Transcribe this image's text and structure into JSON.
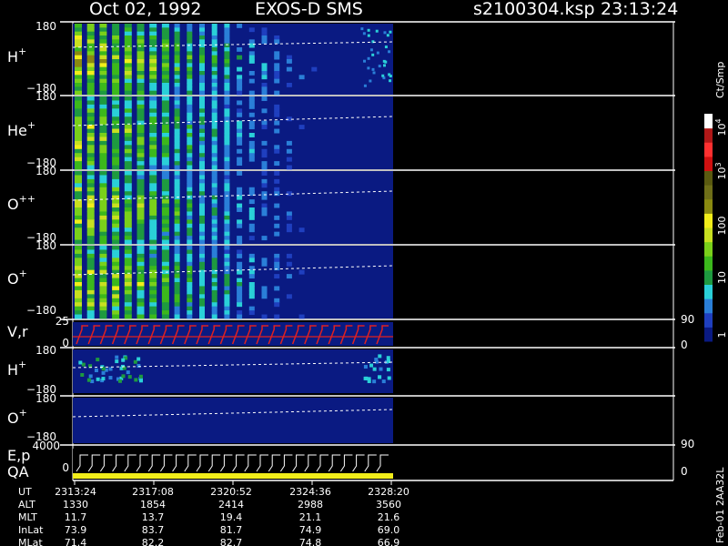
{
  "header": {
    "date": "Oct 02, 1992",
    "instrument": "EXOS-D SMS",
    "file": "s2100304.ksp",
    "time": "23:13:24"
  },
  "colorbar": {
    "unit_label": "Ct/Smp",
    "ticks": [
      {
        "base": "10",
        "exp": "4"
      },
      {
        "base": "10",
        "exp": "3"
      },
      {
        "base": "100",
        "exp": ""
      },
      {
        "base": "10",
        "exp": ""
      },
      {
        "base": "1",
        "exp": ""
      }
    ],
    "colors": [
      "#0a1a82",
      "#1f3fbf",
      "#2a7fd8",
      "#2ad0d8",
      "#1e9a40",
      "#3cb81c",
      "#7ad01a",
      "#c8e020",
      "#f2ee1a",
      "#8a8a10",
      "#6e6e18",
      "#5a5a10",
      "#d01010",
      "#ff3030",
      "#b01818",
      "#ffffff"
    ]
  },
  "side_label": "Feb-01 2AA32L",
  "panels": {
    "h_plus": {
      "name": "H",
      "charge": "+",
      "ymax": "180",
      "ymin": "−180"
    },
    "he_plus": {
      "name": "He",
      "charge": "+",
      "ymax": "180",
      "ymin": "−180"
    },
    "o_plusplus": {
      "name": "O",
      "charge": "++",
      "ymax": "180",
      "ymin": "−180"
    },
    "o_plus": {
      "name": "O",
      "charge": "+",
      "ymax": "180",
      "ymin": "−180"
    },
    "vr": {
      "name": "V,r",
      "left_top": "25",
      "left_bottom": "0",
      "right_top": "90",
      "right_bottom": "0"
    },
    "h_plus_2": {
      "name": "H",
      "charge": "+",
      "ymax": "180",
      "ymin": "−180"
    },
    "o_plus_2": {
      "name": "O",
      "charge": "+",
      "ymax": "180",
      "ymin": "−180"
    },
    "ep": {
      "name": "E,p",
      "name2": "QA",
      "left_top": "4000",
      "left_bottom": "0",
      "right_top": "90",
      "right_bottom": "0"
    }
  },
  "ephemeris": {
    "rows": [
      {
        "label": "UT",
        "values": [
          "2313:24",
          "2317:08",
          "2320:52",
          "2324:36",
          "2328:20"
        ]
      },
      {
        "label": "ALT",
        "values": [
          "1330",
          "1854",
          "2414",
          "2988",
          "3560"
        ]
      },
      {
        "label": "MLT",
        "values": [
          "11.7",
          "13.7",
          "19.4",
          "21.1",
          "21.6"
        ]
      },
      {
        "label": "InLat",
        "values": [
          "73.9",
          "83.7",
          "81.7",
          "74.9",
          "69.0"
        ]
      },
      {
        "label": "MLat",
        "values": [
          "71.4",
          "82.2",
          "82.7",
          "74.8",
          "66.9"
        ]
      }
    ]
  },
  "chart_data": {
    "type": "heatmap",
    "description_panels": [
      "H+",
      "He+",
      "O++",
      "O+",
      "V,r",
      "H+",
      "O+",
      "E,p QA"
    ],
    "x_ticks_ut": [
      "2313:24",
      "2317:08",
      "2320:52",
      "2324:36",
      "2328:20"
    ],
    "y_range_angle": [
      -180,
      180
    ],
    "color_scale": "log",
    "color_range": [
      1,
      10000
    ],
    "color_unit": "Ct/Smp"
  }
}
